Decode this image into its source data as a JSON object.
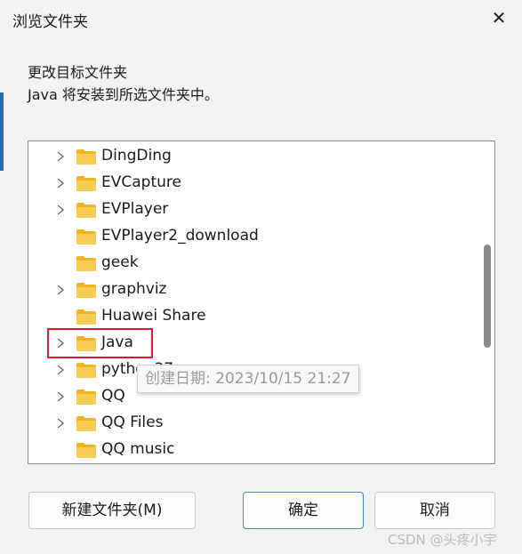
{
  "dialog": {
    "title": "浏览文件夹",
    "instruction_line1": "更改目标文件夹",
    "instruction_line2": "Java 将安装到所选文件夹中。"
  },
  "tree": {
    "items": [
      {
        "label": "DingDing",
        "expandable": true
      },
      {
        "label": "EVCapture",
        "expandable": true
      },
      {
        "label": "EVPlayer",
        "expandable": true
      },
      {
        "label": "EVPlayer2_download",
        "expandable": false
      },
      {
        "label": "geek",
        "expandable": false
      },
      {
        "label": "graphviz",
        "expandable": true
      },
      {
        "label": "Huawei Share",
        "expandable": false
      },
      {
        "label": "Java",
        "expandable": true,
        "hovered": true
      },
      {
        "label": "python37",
        "expandable": true
      },
      {
        "label": "QQ",
        "expandable": true
      },
      {
        "label": "QQ Files",
        "expandable": true
      },
      {
        "label": "QQ music",
        "expandable": false
      }
    ],
    "tooltip": "创建日期: 2023/10/15 21:27"
  },
  "buttons": {
    "new_folder": "新建文件夹(M)",
    "ok": "确定",
    "cancel": "取消"
  },
  "watermark": "CSDN @头疼小宇",
  "colors": {
    "accent": "#4a7fc0",
    "highlight_box": "#e0182d",
    "folder": "#f5c242"
  },
  "icons": {
    "close": "close-icon",
    "expand": "chevron-right-icon",
    "folder": "folder-icon"
  }
}
